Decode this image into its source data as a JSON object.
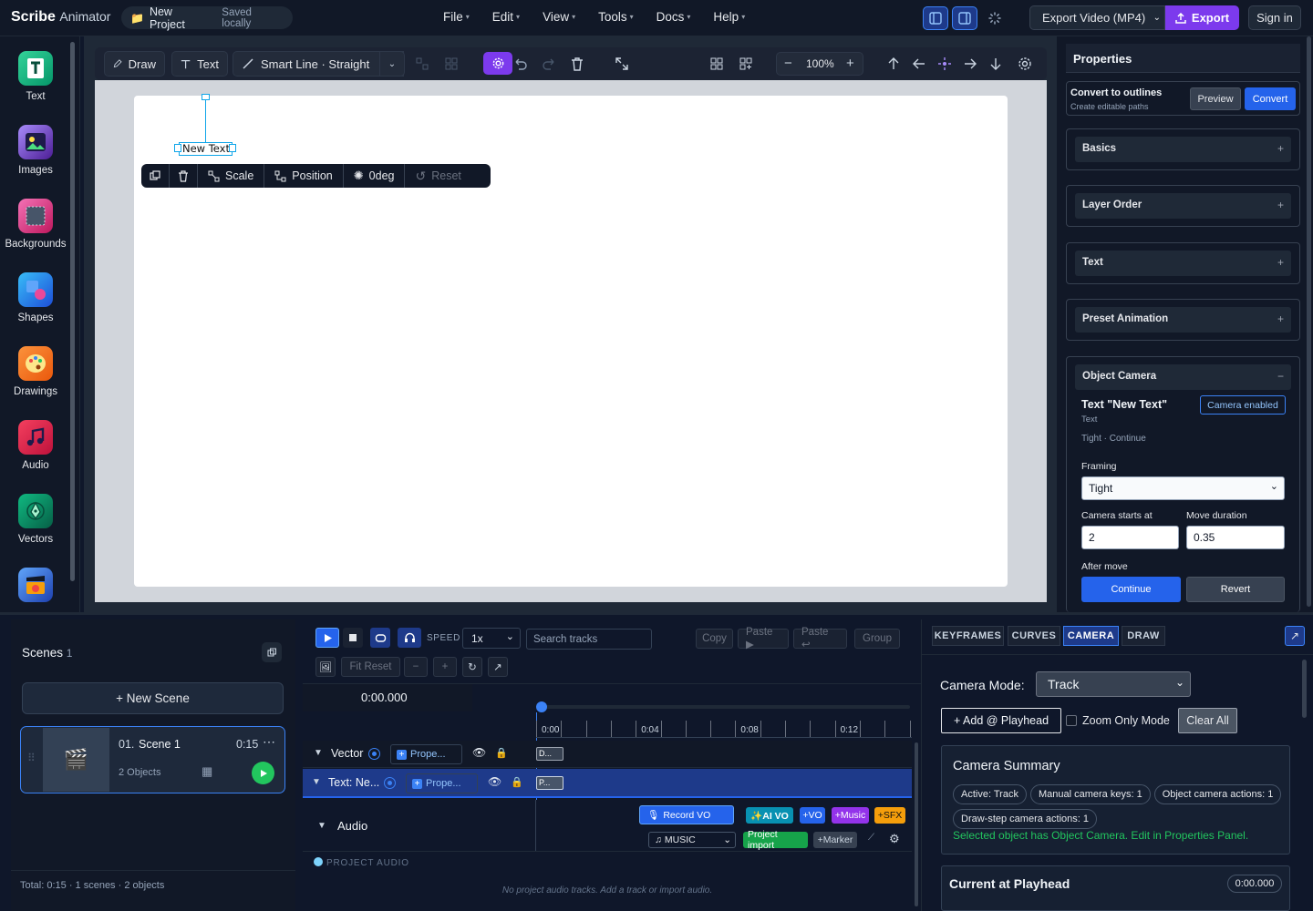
{
  "topbar": {
    "brand": "Scribe",
    "brand_sub": "Animator",
    "project_name": "New Project",
    "save_status": "Saved locally",
    "menus": [
      "File",
      "Edit",
      "View",
      "Tools",
      "Docs",
      "Help"
    ],
    "export_format": "Export Video (MP4)",
    "export_label": "Export",
    "signin_label": "Sign in"
  },
  "dock": {
    "items": [
      {
        "label": "Text",
        "icon": "text-icon"
      },
      {
        "label": "Images",
        "icon": "image-icon"
      },
      {
        "label": "Backgrounds",
        "icon": "background-icon"
      },
      {
        "label": "Shapes",
        "icon": "shapes-icon"
      },
      {
        "label": "Drawings",
        "icon": "palette-icon"
      },
      {
        "label": "Audio",
        "icon": "music-icon"
      },
      {
        "label": "Vectors",
        "icon": "pen-nib-icon"
      },
      {
        "label": "",
        "icon": "clapper-icon"
      }
    ]
  },
  "toolbar": {
    "draw": "Draw",
    "text": "Text",
    "smart_line": "Smart Line · Straight",
    "zoom": "100%"
  },
  "canvas": {
    "object_text": "New Text",
    "float_scale": "Scale",
    "float_position": "Position",
    "float_rotation": "0deg",
    "float_reset": "Reset"
  },
  "properties": {
    "title": "Properties",
    "convert_title": "Convert to outlines",
    "convert_sub": "Create editable paths",
    "preview_label": "Preview",
    "convert_label": "Convert",
    "sections": [
      "Basics",
      "Layer Order",
      "Text",
      "Preset Animation"
    ],
    "object_camera": {
      "title": "Object Camera",
      "object_name": "Text \"New Text\"",
      "object_type": "Text",
      "summary": "Tight · Continue",
      "badge": "Camera enabled",
      "framing_label": "Framing",
      "framing_value": "Tight",
      "starts_label": "Camera starts at",
      "starts_value": "2",
      "duration_label": "Move duration",
      "duration_value": "0.35",
      "after_label": "After move",
      "continue_label": "Continue",
      "revert_label": "Revert"
    }
  },
  "scenes": {
    "title": "Scenes",
    "count": "1",
    "new_scene": "+ New Scene",
    "scene": {
      "index": "01.",
      "name": "Scene 1",
      "duration": "0:15",
      "objects": "2 Objects"
    },
    "footer": "Total: 0:15 · 1 scenes · 2 objects"
  },
  "timeline": {
    "speed_label": "SPEED",
    "speed_value": "1x",
    "search_placeholder": "Search tracks",
    "copy": "Copy",
    "paste": "Paste ▶",
    "paste2": "Paste ↩",
    "group": "Group",
    "fit_reset": "Fit Reset",
    "time": "0:00.000",
    "ticks": [
      "0:00",
      "0:04",
      "0:08",
      "0:12"
    ],
    "tracks": [
      {
        "name": "Vector",
        "prop": "Prope...",
        "clip": "D..."
      },
      {
        "name": "Text: Ne...",
        "prop": "Prope...",
        "clip": "P..."
      }
    ],
    "audio_label": "Audio",
    "record_vo": "Record VO",
    "ai_vo": "✨AI VO",
    "vo": "+VO",
    "music": "+Music",
    "sfx": "+SFX",
    "music_select": "MUSIC",
    "project_import": "Project import",
    "marker": "+Marker",
    "project_audio": "PROJECT AUDIO",
    "no_audio": "No project audio tracks. Add a track or import audio."
  },
  "camera_panel": {
    "tabs": [
      "KEYFRAMES",
      "CURVES",
      "CAMERA",
      "DRAW"
    ],
    "mode_label": "Camera Mode:",
    "mode_value": "Track",
    "add_playhead": "+ Add @ Playhead",
    "zoom_only": "Zoom Only Mode",
    "clear_all": "Clear All",
    "summary_title": "Camera Summary",
    "summary_tags": [
      "Active: Track",
      "Manual camera keys: 1",
      "Object camera actions: 1",
      "Draw-step camera actions: 1"
    ],
    "summary_note": "Selected object has Object Camera. Edit in Properties Panel.",
    "current_title": "Current at Playhead",
    "current_time": "0:00.000"
  },
  "colors": {
    "accent_purple": "#7c3aed",
    "accent_blue": "#2563eb",
    "success_green": "#22c55e"
  }
}
